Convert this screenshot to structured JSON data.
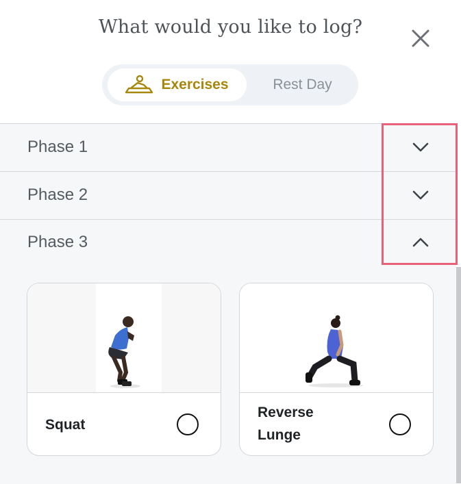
{
  "header": {
    "title": "What would you like to log?"
  },
  "toggle": {
    "exercises_label": "Exercises",
    "rest_day_label": "Rest Day",
    "selected": "Exercises",
    "accent_color": "#a8860b"
  },
  "phases": [
    {
      "label": "Phase 1",
      "expanded": false,
      "icon": "chevron-down-icon"
    },
    {
      "label": "Phase 2",
      "expanded": false,
      "icon": "chevron-down-icon"
    },
    {
      "label": "Phase 3",
      "expanded": true,
      "icon": "chevron-up-icon"
    }
  ],
  "exercises": [
    {
      "name": "Squat",
      "selected": false
    },
    {
      "name_line1": "Reverse",
      "name_line2": "Lunge",
      "selected": false
    }
  ],
  "highlight_color": "#e8607a"
}
